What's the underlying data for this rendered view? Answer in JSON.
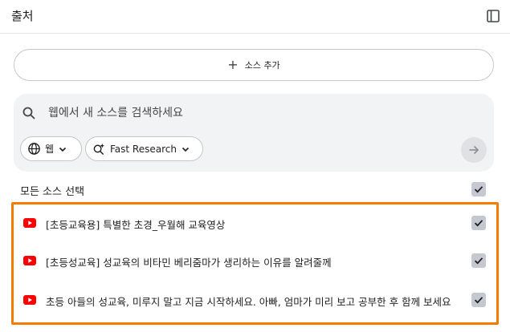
{
  "header": {
    "title": "출처",
    "toggle_icon": "panel-toggle-icon"
  },
  "add_source": {
    "icon": "plus-icon",
    "label": "소스 추가"
  },
  "search": {
    "placeholder": "웹에서 새 소스를 검색하세요",
    "value": "",
    "chips": [
      {
        "icon": "globe-icon",
        "label": "웹"
      },
      {
        "icon": "sparkle-search-icon",
        "label": "Fast Research"
      }
    ],
    "submit_icon": "arrow-right-icon"
  },
  "select_all": {
    "label": "모든 소스 선택",
    "checked": true
  },
  "sources": [
    {
      "icon": "youtube-icon",
      "title": "[초등교육용] 특별한 초경_우월해 교육영상",
      "checked": true
    },
    {
      "icon": "youtube-icon",
      "title": "[초등성교육] 성교육의 비타민 베리줌마가 생리하는 이유를 알려줄께",
      "checked": true
    },
    {
      "icon": "youtube-icon",
      "title": "초등 아들의 성교육, 미루지 말고 지금 시작하세요. 아빠, 엄마가 미리 보고 공부한 후 함께 보세요",
      "checked": true
    }
  ],
  "colors": {
    "highlight": "#f57c00",
    "youtube": "#ff0000",
    "checkbox": "#c4c8d0"
  }
}
